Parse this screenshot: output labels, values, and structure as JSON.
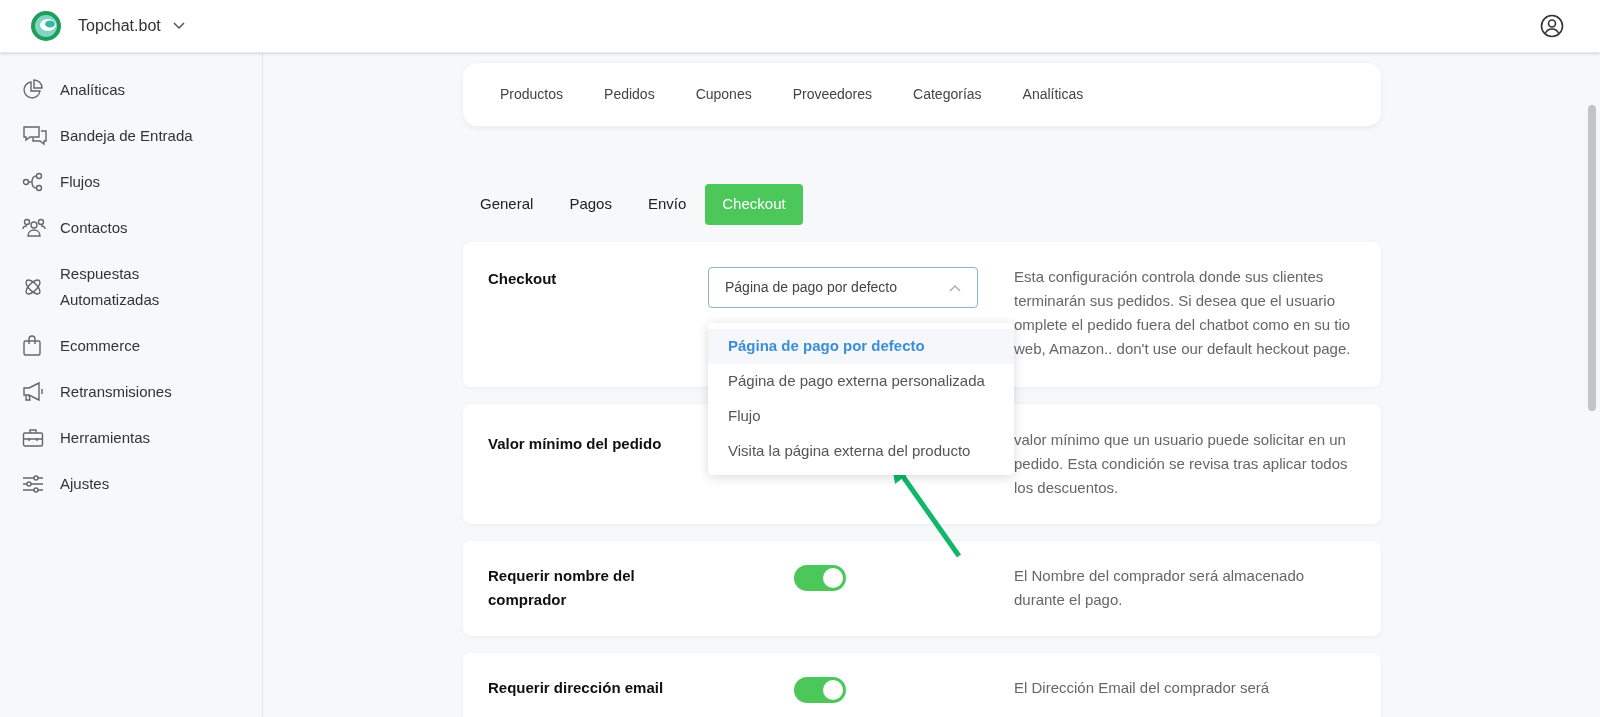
{
  "header": {
    "brand": "Topchat.bot"
  },
  "sidebar": {
    "items": [
      {
        "label": "Analíticas"
      },
      {
        "label": "Bandeja de Entrada"
      },
      {
        "label": "Flujos"
      },
      {
        "label": "Contactos"
      },
      {
        "label": "Respuestas Automatizadas"
      },
      {
        "label": "Ecommerce"
      },
      {
        "label": "Retransmisiones"
      },
      {
        "label": "Herramientas"
      },
      {
        "label": "Ajustes"
      }
    ]
  },
  "top_tabs": [
    "Productos",
    "Pedidos",
    "Cupones",
    "Proveedores",
    "Categorías",
    "Analíticas"
  ],
  "tabs": [
    {
      "label": "General",
      "selected": false
    },
    {
      "label": "Pagos",
      "selected": false
    },
    {
      "label": "Envío",
      "selected": false
    },
    {
      "label": "Checkout",
      "selected": true
    }
  ],
  "settings": [
    {
      "kind": "select",
      "label": "Checkout",
      "value": "Página de pago por defecto",
      "expanded": true,
      "options": [
        {
          "label": "Página de pago por defecto",
          "selected": true
        },
        {
          "label": "Página de pago externa personalizada",
          "selected": false
        },
        {
          "label": "Flujo",
          "selected": false
        },
        {
          "label": "Visita la página externa del producto",
          "selected": false
        }
      ],
      "description": "Esta configuración controla donde sus clientes terminarán sus pedidos. Si desea que el usuario omplete el pedido fuera del chatbot como en su tio web, Amazon.. don't use our default heckout page."
    },
    {
      "kind": "blank",
      "label": "Valor mínimo del pedido",
      "description": "valor mínimo que un usuario puede solicitar en un pedido. Esta condición se revisa tras aplicar todos los descuentos."
    },
    {
      "kind": "toggle",
      "label": "Requerir nombre del comprador",
      "on": true,
      "description": "El Nombre del comprador será almacenado durante el pago."
    },
    {
      "kind": "toggle",
      "label": "Requerir dirección email",
      "on": true,
      "description": "El Dirección Email del comprador será"
    }
  ]
}
